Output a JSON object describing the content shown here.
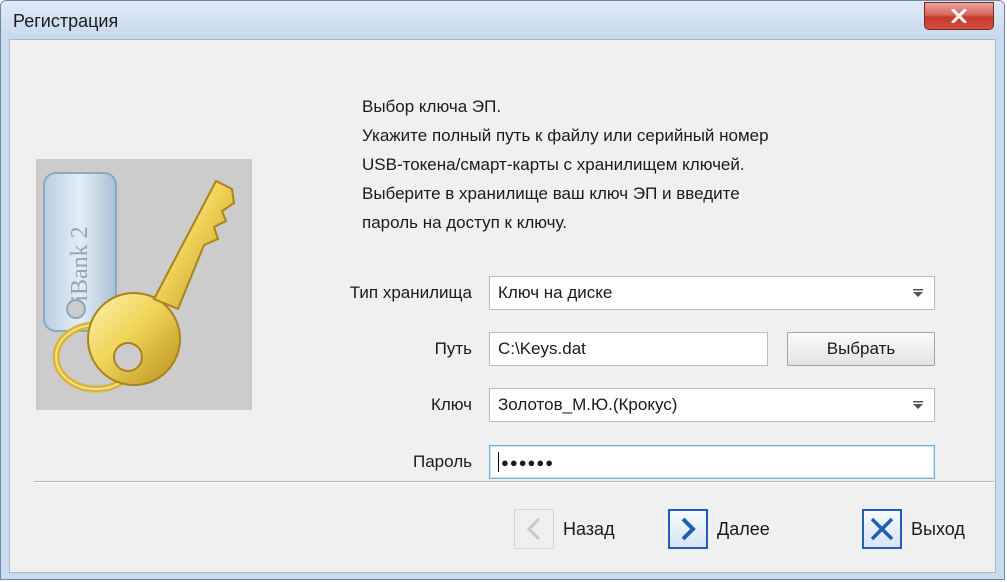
{
  "window": {
    "title": "Регистрация"
  },
  "description": {
    "lines": [
      "Выбор ключа ЭП.",
      "Укажите полный путь к файлу или серийный номер",
      "USB-токена/смарт-карты с хранилищем ключей.",
      "Выберите в хранилище ваш ключ ЭП и введите",
      "пароль на доступ к ключу."
    ]
  },
  "image": {
    "tag_text": "iBank 2"
  },
  "form": {
    "storage_type": {
      "label": "Тип хранилища",
      "value": "Ключ на диске"
    },
    "path": {
      "label": "Путь",
      "value": "C:\\Keys.dat",
      "browse_label": "Выбрать"
    },
    "key": {
      "label": "Ключ",
      "value": "Золотов_М.Ю.(Крокус)"
    },
    "password": {
      "label": "Пароль",
      "value": "●●●●●●"
    }
  },
  "buttons": {
    "back": "Назад",
    "next": "Далее",
    "exit": "Выход"
  },
  "colors": {
    "accent_blue": "#1e5fb4",
    "close_red": "#c5392b"
  }
}
